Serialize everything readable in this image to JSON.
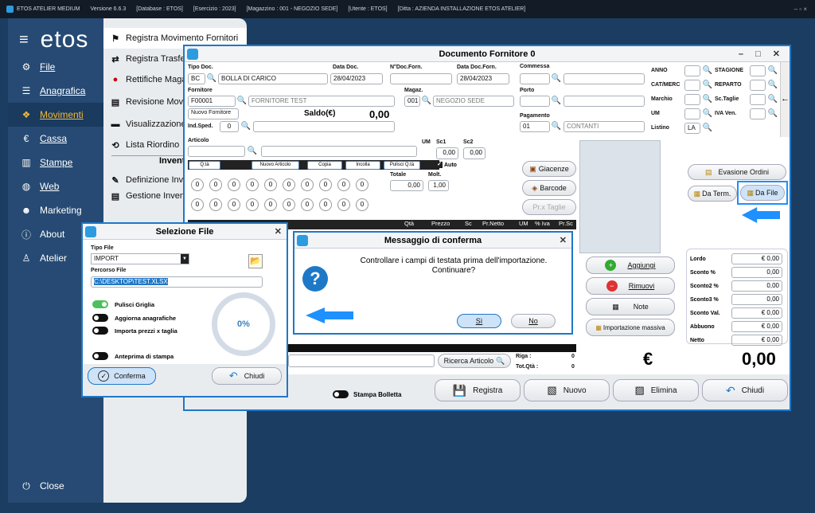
{
  "titlebar": {
    "app": "ETOS ATELIER MEDIUM",
    "version": "Versione 6.6.3",
    "database": "[Database : ETOS]",
    "exercise": "[Esercizio : 2023]",
    "warehouse": "[Magazzino : 001 - NEGOZIO SEDE]",
    "user": "[Utente : ETOS]",
    "company": "[Ditta : AZIENDA INSTALLAZIONE ETOS ATELIER]",
    "controls": "– ▫ ×"
  },
  "sidebar": {
    "brand": "etos",
    "items": [
      {
        "label": "File",
        "icon": "gear-icon"
      },
      {
        "label": "Anagrafica",
        "icon": "database-icon"
      },
      {
        "label": "Movimenti",
        "icon": "cubes-icon"
      },
      {
        "label": "Cassa",
        "icon": "euro-icon"
      },
      {
        "label": "Stampe",
        "icon": "chart-icon"
      },
      {
        "label": "Web",
        "icon": "globe-icon"
      },
      {
        "label": "Marketing",
        "icon": "users-icon"
      },
      {
        "label": "About",
        "icon": "info-icon"
      },
      {
        "label": "Atelier",
        "icon": "person-icon"
      }
    ],
    "close": "Close"
  },
  "submenu": {
    "items": [
      "Registra Movimento Fornitori",
      "Registra Trasferi",
      "Rettifiche Magaz",
      "Revisione Movim",
      "Visualizzazione C",
      "Lista Riordino"
    ],
    "section": "Inventa",
    "items2": [
      "Definizione Inve",
      "Gestione Inventa"
    ]
  },
  "doc": {
    "title": "Documento Fornitore 0",
    "tipo_doc_label": "Tipo Doc.",
    "tipo_doc_code": "BC",
    "tipo_doc_desc": "BOLLA DI CARICO",
    "data_doc_label": "Data Doc.",
    "data_doc": "28/04/2023",
    "ndoc_label": "N°Doc.Forn.",
    "data_doc_forn_label": "Data Doc.Forn.",
    "data_doc_forn": "28/04/2023",
    "commessa_label": "Commessa",
    "fornitore_label": "Fornitore",
    "fornitore_code": "F00001",
    "fornitore_desc": "FORNITORE TEST",
    "nuovo_fornitore": "Nuovo Fornitore",
    "saldo_label": "Saldo(€)",
    "saldo": "0,00",
    "magaz_label": "Magaz.",
    "magaz_code": "001",
    "magaz_desc": "NEGOZIO SEDE",
    "porto_label": "Porto",
    "pagamento_label": "Pagamento",
    "pagamento_code": "01",
    "pagamento_desc": "CONTANTI",
    "ind_sped_label": "Ind.Sped.",
    "ind_sped": "0",
    "anno_label": "ANNO",
    "stagione_label": "STAGIONE",
    "catmerc_label": "CAT/MERC",
    "reparto_label": "REPARTO",
    "marchio_label": "Marchio",
    "sctaglie_label": "Sc.Taglie",
    "um_label": "UM",
    "ivaven_label": "IVA Ven.",
    "listino_label": "Listino",
    "listino": "LA",
    "articolo_label": "Articolo",
    "um2_label": "UM",
    "sc1_label": "Sc1",
    "sc2_label": "Sc2",
    "sc1": "0,00",
    "sc2": "0,00",
    "qta_tab": "Q.tà",
    "tabs": [
      "Nuovo Articolo",
      "Copia",
      "Incolla",
      "Pulisci Q.tà"
    ],
    "auto": "Auto",
    "totale_label": "Totale",
    "molt_label": "Molt.",
    "totale": "0,00",
    "molt": "1,00",
    "qty_row1": [
      "0",
      "0",
      "0",
      "0",
      "0",
      "0",
      "0",
      "0",
      "0",
      "0"
    ],
    "qty_row2": [
      "0",
      "0",
      "0",
      "0",
      "0",
      "0",
      "0",
      "0",
      "0",
      "0"
    ],
    "giacenze": "Giacenze",
    "barcode": "Barcode",
    "prx_taglie": "Pr.x Taglie",
    "evasione_ordini": "Evasione Ordini",
    "da_term": "Da Term.",
    "da_file": "Da File",
    "grid_headers": [
      "Qtà",
      "Prezzo",
      "Sc",
      "Pr.Netto",
      "UM",
      "% Iva",
      "Pr.Sc"
    ],
    "aggiungi": "Aggiungi",
    "rimuovi": "Rimuovi",
    "note": "Note",
    "importazione_massiva": "Importazione massiva",
    "totals": [
      {
        "label": "Lordo",
        "value": "€ 0,00"
      },
      {
        "label": "Sconto %",
        "value": "0,00"
      },
      {
        "label": "Sconto2 %",
        "value": "0,00"
      },
      {
        "label": "Sconto3 %",
        "value": "0,00"
      },
      {
        "label": "Sconto Val.",
        "value": "€ 0,00"
      },
      {
        "label": "Abbuono",
        "value": "€ 0,00"
      },
      {
        "label": "Netto",
        "value": "€ 0,00"
      }
    ],
    "ricerca_articolo": "Ricerca Articolo",
    "riga_label": "Riga :",
    "riga": "0",
    "totqta_label": "Tot.Qtà :",
    "totqta": "0",
    "euro": "€",
    "grand_total": "0,00",
    "stampa_bolletta": "Stampa Bolletta",
    "registra": "Registra",
    "nuovo": "Nuovo",
    "elimina": "Elimina",
    "chiudi": "Chiudi"
  },
  "selezione": {
    "title": "Selezione File",
    "tipo_file_label": "Tipo File",
    "tipo_file": "IMPORT",
    "percorso_label": "Percorso File",
    "percorso": "C:\\DESKTOP\\TEST.XLSX",
    "pulisci_griglia": "Pulisci Griglia",
    "aggiorna": "Aggiorna anagrafiche",
    "importa": "Importa prezzi x taglia",
    "anteprima": "Anteprima di stampa",
    "progress": 0,
    "progress_label": "0%",
    "conferma": "Conferma",
    "chiudi": "Chiudi"
  },
  "messaggio": {
    "title": "Messaggio di conferma",
    "text1": "Controllare i campi di testata prima dell'importazione.",
    "text2": "Continuare?",
    "si": "Sì",
    "no": "No"
  },
  "colors": {
    "accent": "#1e78c8",
    "sidebar": "#264a73",
    "highlight": "#1e90ff"
  }
}
